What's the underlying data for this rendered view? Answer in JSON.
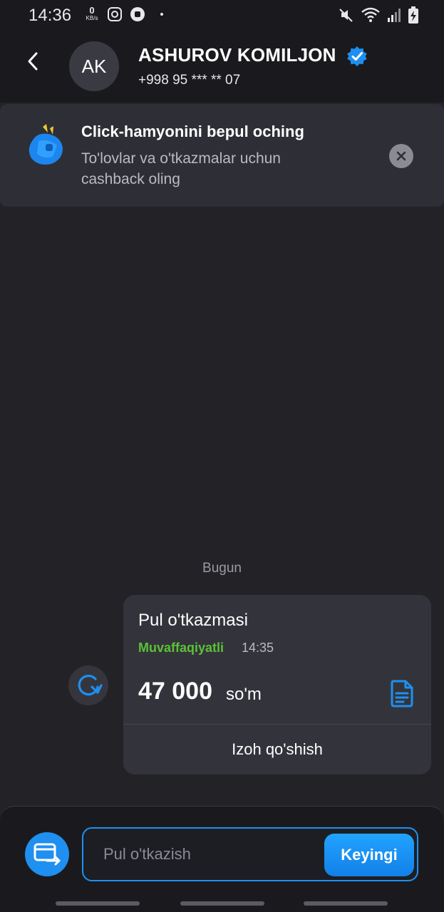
{
  "status_bar": {
    "time": "14:36",
    "net_speed_value": "0",
    "net_speed_unit": "KB/s",
    "icons": [
      "instagram-icon",
      "football-icon",
      "dot-icon",
      "mute-icon",
      "wifi-icon",
      "signal-icon",
      "battery-charging-icon"
    ]
  },
  "header": {
    "avatar_initials": "AK",
    "name": "ASHUROV KOMILJON",
    "phone": "+998 95 *** ** 07",
    "verified": true
  },
  "promo": {
    "title": "Click-hamyonini bepul oching",
    "text": "To'lovlar va o'tkazmalar uchun cashback oling"
  },
  "chat": {
    "date_label": "Bugun",
    "transaction": {
      "title": "Pul o'tkazmasi",
      "status": "Muvaffaqiyatli",
      "time": "14:35",
      "amount": "47 000",
      "currency": "so'm",
      "comment_label": "Izoh qo'shish"
    }
  },
  "input_bar": {
    "placeholder": "Pul o'tkazish",
    "next_label": "Keyingi"
  },
  "colors": {
    "background": "#222227",
    "header": "#1a1a1e",
    "card": "#33343b",
    "accent": "#1f8ff0",
    "success": "#5bc236",
    "muted_text": "#b9bac2"
  }
}
